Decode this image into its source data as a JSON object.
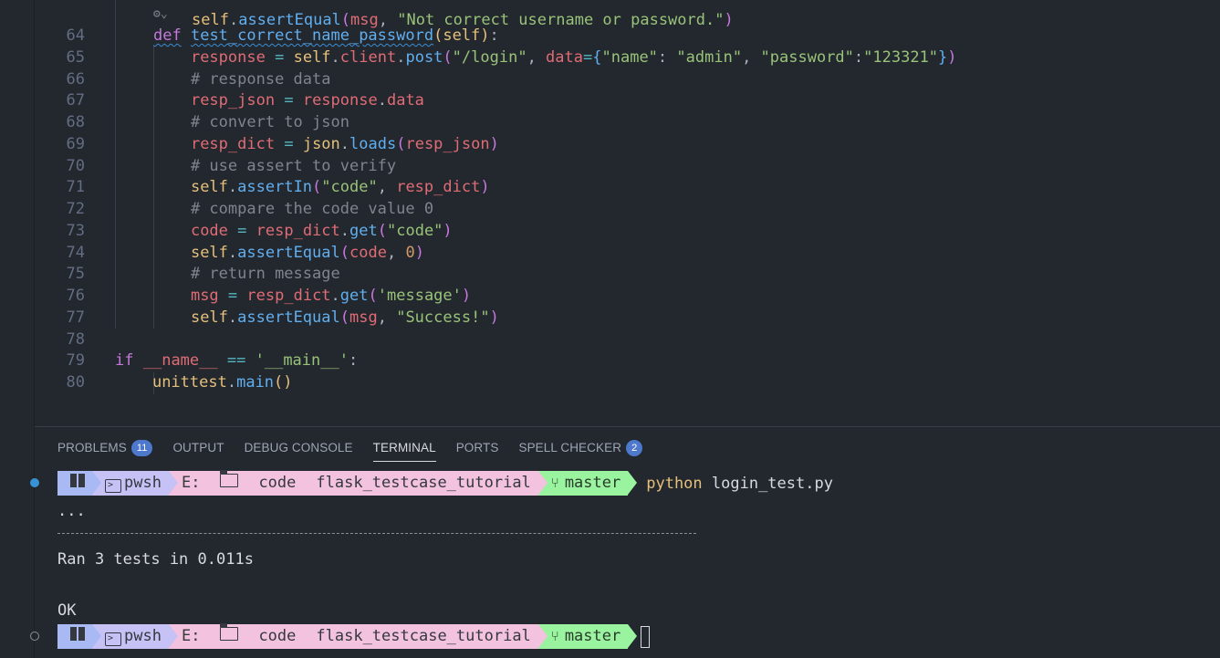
{
  "editor": {
    "lines": [
      {
        "num": "64",
        "html": "<span class=\"kw squig\">def</span> <span class=\"fn squig\">test_correct_name_password</span><span class=\"br1\">(</span><span class=\"self\">self</span><span class=\"br1\">)</span><span class=\"plain\">:</span>"
      },
      {
        "num": "65",
        "html": "    <span class=\"var\">response</span> <span class=\"op\">=</span> <span class=\"self\">self</span><span class=\"plain\">.</span><span class=\"var\">client</span><span class=\"plain\">.</span><span class=\"fn\">post</span><span class=\"br2\">(</span><span class=\"str\">\"/login\"</span><span class=\"plain\">, </span><span class=\"var\">data</span><span class=\"op\">=</span><span class=\"br3\">{</span><span class=\"str\">\"name\"</span><span class=\"plain\">: </span><span class=\"str\">\"admin\"</span><span class=\"plain\">, </span><span class=\"str\">\"password\"</span><span class=\"plain\">:</span><span class=\"str\">\"123321\"</span><span class=\"br3\">}</span><span class=\"br2\">)</span>"
      },
      {
        "num": "66",
        "html": "    <span class=\"cmt\"># response data</span>"
      },
      {
        "num": "67",
        "html": "    <span class=\"var\">resp_json</span> <span class=\"op\">=</span> <span class=\"var\">response</span><span class=\"plain\">.</span><span class=\"var\">data</span>"
      },
      {
        "num": "68",
        "html": "    <span class=\"cmt\"># convert to json</span>"
      },
      {
        "num": "69",
        "html": "    <span class=\"var\">resp_dict</span> <span class=\"op\">=</span> <span class=\"self\">json</span><span class=\"plain\">.</span><span class=\"fn\">loads</span><span class=\"br2\">(</span><span class=\"var\">resp_json</span><span class=\"br2\">)</span>"
      },
      {
        "num": "70",
        "html": "    <span class=\"cmt\"># use assert to verify</span>"
      },
      {
        "num": "71",
        "html": "    <span class=\"self\">self</span><span class=\"plain\">.</span><span class=\"fn\">assertIn</span><span class=\"br2\">(</span><span class=\"str\">\"code\"</span><span class=\"plain\">, </span><span class=\"var\">resp_dict</span><span class=\"br2\">)</span>"
      },
      {
        "num": "72",
        "html": "    <span class=\"cmt\"># compare the code value 0</span>"
      },
      {
        "num": "73",
        "html": "    <span class=\"var\">code</span> <span class=\"op\">=</span> <span class=\"var\">resp_dict</span><span class=\"plain\">.</span><span class=\"fn\">get</span><span class=\"br2\">(</span><span class=\"str\">\"code\"</span><span class=\"br2\">)</span>"
      },
      {
        "num": "74",
        "html": "    <span class=\"self\">self</span><span class=\"plain\">.</span><span class=\"fn\">assertEqual</span><span class=\"br2\">(</span><span class=\"var\">code</span><span class=\"plain\">, </span><span class=\"num\">0</span><span class=\"br2\">)</span>"
      },
      {
        "num": "75",
        "html": "    <span class=\"cmt\"># return message</span>"
      },
      {
        "num": "76",
        "html": "    <span class=\"var\">msg</span> <span class=\"op\">=</span> <span class=\"var\">resp_dict</span><span class=\"plain\">.</span><span class=\"fn\">get</span><span class=\"br2\">(</span><span class=\"str\">'message'</span><span class=\"br2\">)</span>"
      },
      {
        "num": "77",
        "html": "    <span class=\"self\">self</span><span class=\"plain\">.</span><span class=\"fn\">assertEqual</span><span class=\"br2\">(</span><span class=\"var\">msg</span><span class=\"plain\">, </span><span class=\"str\">\"Success!\"</span><span class=\"br2\">)</span>"
      },
      {
        "num": "78",
        "html": ""
      },
      {
        "num": "79",
        "html": "<span class=\"kw\">if</span> <span class=\"var\">__name__</span> <span class=\"op\">==</span> <span class=\"str\">'__main__'</span><span class=\"plain\">:</span>"
      },
      {
        "num": "80",
        "html": "    <span class=\"self\">unittest</span><span class=\"plain\">.</span><span class=\"fn\">main</span><span class=\"br1\">()</span>"
      }
    ]
  },
  "panel": {
    "tabs": [
      {
        "label": "PROBLEMS",
        "badge": "11",
        "active": false
      },
      {
        "label": "OUTPUT",
        "badge": "",
        "active": false
      },
      {
        "label": "DEBUG CONSOLE",
        "badge": "",
        "active": false
      },
      {
        "label": "TERMINAL",
        "badge": "",
        "active": true
      },
      {
        "label": "PORTS",
        "badge": "",
        "active": false
      },
      {
        "label": "SPELL CHECKER",
        "badge": "2",
        "active": false
      }
    ]
  },
  "terminal": {
    "prompt": {
      "shell": "pwsh",
      "drive": "E:",
      "dir1": "code",
      "dir2": "flask_testcase_tutorial",
      "branch": "master"
    },
    "command_program": "python",
    "command_args": " login_test.py",
    "dots": "...",
    "ran": "Ran 3 tests in 0.011s",
    "ok": "OK"
  }
}
